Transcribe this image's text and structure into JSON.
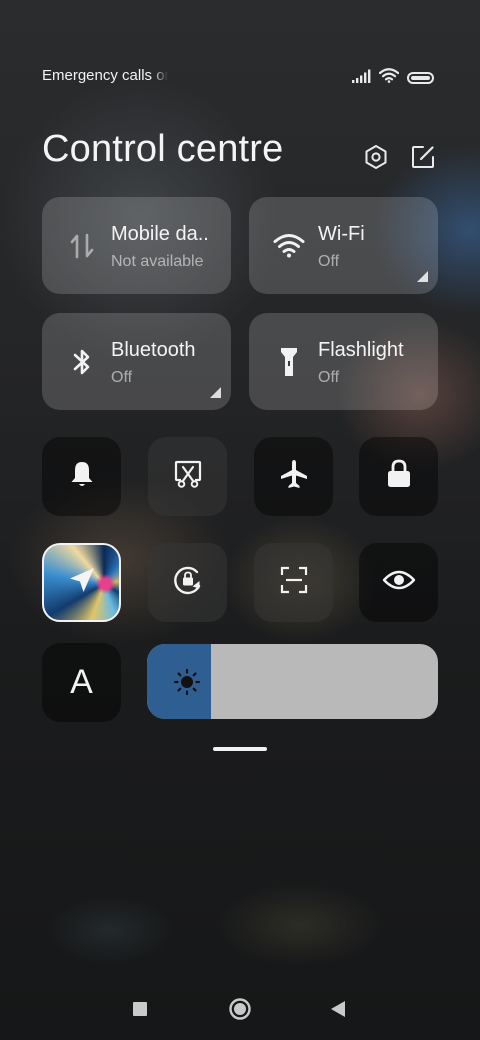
{
  "status_bar": {
    "carrier_text": "Emergency calls only",
    "signal_icon": "signal-bars-icon",
    "wifi_icon": "wifi-icon",
    "battery_icon": "battery-icon",
    "battery_level": 1.0
  },
  "header": {
    "title": "Control centre",
    "settings_icon": "settings-hexagon-icon",
    "edit_icon": "edit-icon"
  },
  "tiles": [
    {
      "title": "Mobile da..",
      "subtitle": "Not available",
      "icon": "mobile-data-icon"
    },
    {
      "title": "Wi-Fi",
      "subtitle": "Off",
      "icon": "wifi-icon"
    },
    {
      "title": "Bluetooth",
      "subtitle": "Off",
      "icon": "bluetooth-icon"
    },
    {
      "title": "Flashlight",
      "subtitle": "Off",
      "icon": "flashlight-icon"
    }
  ],
  "toggles_row1": [
    "bell-icon",
    "screenshot-scissors-icon",
    "airplane-icon",
    "lock-icon"
  ],
  "toggles_row2": [
    "location-arrow-icon",
    "rotation-lock-icon",
    "scan-icon",
    "eye-icon"
  ],
  "reading_mode": {
    "label": "A",
    "icon": "font-size-icon"
  },
  "brightness": {
    "level": 0.22,
    "icon": "sun-icon"
  },
  "nav_bar": {
    "recents_icon": "recents-square-icon",
    "home_icon": "home-circle-icon",
    "back_icon": "back-triangle-icon"
  },
  "colors": {
    "brightness_fill": "#2f5f92",
    "slider_track": "#b9b9b9"
  }
}
